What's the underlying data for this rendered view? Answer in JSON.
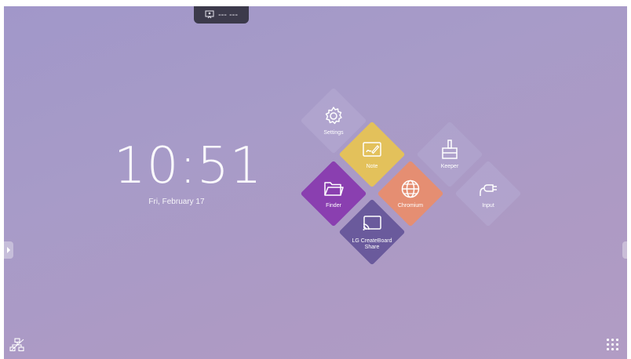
{
  "top_pill": {
    "text": "--- ---"
  },
  "clock": {
    "time": "10:51",
    "date": "Fri, February 17"
  },
  "tiles": [
    {
      "label": "Settings",
      "color": "#b6abd3",
      "icon": "gear-icon"
    },
    {
      "label": "Note",
      "color": "#e3c15b",
      "icon": "note-pen-icon"
    },
    {
      "label": "Keeper",
      "color": "#b3a8d1",
      "icon": "broom-icon"
    },
    {
      "label": "Finder",
      "color": "#8a3fb0",
      "icon": "folder-icon"
    },
    {
      "label": "Chromium",
      "color": "#e58e72",
      "icon": "globe-icon"
    },
    {
      "label": "Input",
      "color": "#b6abd3",
      "icon": "plug-icon"
    },
    {
      "label": "LG CreateBoard Share",
      "color": "#6a5a9c",
      "icon": "screen-cast-icon"
    }
  ],
  "colors": {
    "background": "#a79bc8",
    "pill": "#3c3a4b"
  }
}
